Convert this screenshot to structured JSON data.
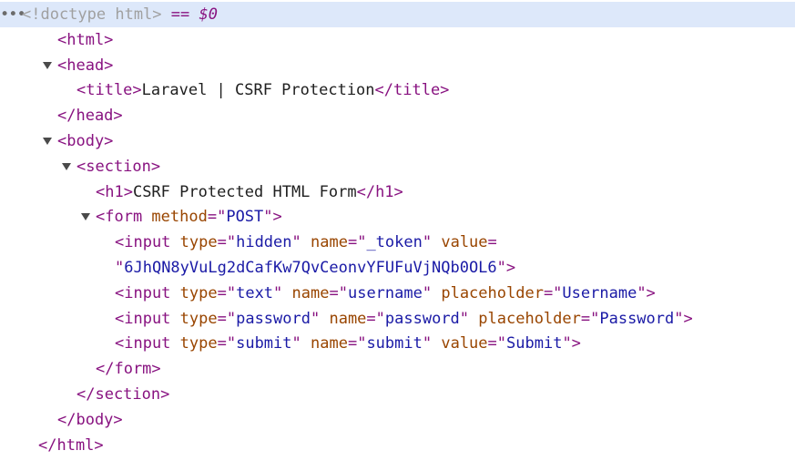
{
  "lines": [
    {
      "indent": 0,
      "selected": true,
      "dots": "•••",
      "tokens": [
        {
          "t": "dim",
          "v": "<!doctype html>"
        },
        {
          "t": "eq",
          "v": " == "
        },
        {
          "t": "dollar",
          "v": "$0"
        }
      ]
    },
    {
      "indent": 1,
      "tokens": [
        {
          "t": "tag",
          "v": "<html>"
        }
      ]
    },
    {
      "indent": 1,
      "arrow": true,
      "tokens": [
        {
          "t": "tag",
          "v": "<head>"
        }
      ]
    },
    {
      "indent": 2,
      "tokens": [
        {
          "t": "tag",
          "v": "<title>"
        },
        {
          "t": "text",
          "v": "Laravel | CSRF Protection"
        },
        {
          "t": "tag",
          "v": "</title>"
        }
      ]
    },
    {
      "indent": 1,
      "tokens": [
        {
          "t": "tag",
          "v": "</head>"
        }
      ]
    },
    {
      "indent": 1,
      "arrow": true,
      "tokens": [
        {
          "t": "tag",
          "v": "<body>"
        }
      ]
    },
    {
      "indent": 2,
      "arrow": true,
      "tokens": [
        {
          "t": "tag",
          "v": "<section>"
        }
      ]
    },
    {
      "indent": 3,
      "tokens": [
        {
          "t": "tag",
          "v": "<h1>"
        },
        {
          "t": "text",
          "v": "CSRF Protected HTML Form"
        },
        {
          "t": "tag",
          "v": "</h1>"
        }
      ]
    },
    {
      "indent": 3,
      "arrow": true,
      "tokens": [
        {
          "t": "tag",
          "v": "<form"
        },
        {
          "t": "attr",
          "v": " method"
        },
        {
          "t": "tag",
          "v": "=\""
        },
        {
          "t": "val",
          "v": "POST"
        },
        {
          "t": "tag",
          "v": "\">"
        }
      ]
    },
    {
      "indent": 4,
      "tokens": [
        {
          "t": "tag",
          "v": "<input"
        },
        {
          "t": "attr",
          "v": " type"
        },
        {
          "t": "tag",
          "v": "=\""
        },
        {
          "t": "val",
          "v": "hidden"
        },
        {
          "t": "tag",
          "v": "\""
        },
        {
          "t": "attr",
          "v": " name"
        },
        {
          "t": "tag",
          "v": "=\""
        },
        {
          "t": "val",
          "v": "_token"
        },
        {
          "t": "tag",
          "v": "\""
        },
        {
          "t": "attr",
          "v": " value"
        },
        {
          "t": "tag",
          "v": "="
        }
      ]
    },
    {
      "indent": 4,
      "tokens": [
        {
          "t": "tag",
          "v": "\""
        },
        {
          "t": "val",
          "v": "6JhQN8yVuLg2dCafKw7QvCeonvYFUFuVjNQb0OL6"
        },
        {
          "t": "tag",
          "v": "\">"
        }
      ]
    },
    {
      "indent": 4,
      "tokens": [
        {
          "t": "tag",
          "v": "<input"
        },
        {
          "t": "attr",
          "v": " type"
        },
        {
          "t": "tag",
          "v": "=\""
        },
        {
          "t": "val",
          "v": "text"
        },
        {
          "t": "tag",
          "v": "\""
        },
        {
          "t": "attr",
          "v": " name"
        },
        {
          "t": "tag",
          "v": "=\""
        },
        {
          "t": "val",
          "v": "username"
        },
        {
          "t": "tag",
          "v": "\""
        },
        {
          "t": "attr",
          "v": " placeholder"
        },
        {
          "t": "tag",
          "v": "=\""
        },
        {
          "t": "val",
          "v": "Username"
        },
        {
          "t": "tag",
          "v": "\">"
        }
      ]
    },
    {
      "indent": 4,
      "tokens": [
        {
          "t": "tag",
          "v": "<input"
        },
        {
          "t": "attr",
          "v": " type"
        },
        {
          "t": "tag",
          "v": "=\""
        },
        {
          "t": "val",
          "v": "password"
        },
        {
          "t": "tag",
          "v": "\""
        },
        {
          "t": "attr",
          "v": " name"
        },
        {
          "t": "tag",
          "v": "=\""
        },
        {
          "t": "val",
          "v": "password"
        },
        {
          "t": "tag",
          "v": "\""
        },
        {
          "t": "attr",
          "v": " placeholder"
        },
        {
          "t": "tag",
          "v": "=\""
        },
        {
          "t": "val",
          "v": "Password"
        },
        {
          "t": "tag",
          "v": "\">"
        }
      ]
    },
    {
      "indent": 4,
      "tokens": [
        {
          "t": "tag",
          "v": "<input"
        },
        {
          "t": "attr",
          "v": " type"
        },
        {
          "t": "tag",
          "v": "=\""
        },
        {
          "t": "val",
          "v": "submit"
        },
        {
          "t": "tag",
          "v": "\""
        },
        {
          "t": "attr",
          "v": " name"
        },
        {
          "t": "tag",
          "v": "=\""
        },
        {
          "t": "val",
          "v": "submit"
        },
        {
          "t": "tag",
          "v": "\""
        },
        {
          "t": "attr",
          "v": " value"
        },
        {
          "t": "tag",
          "v": "=\""
        },
        {
          "t": "val",
          "v": "Submit"
        },
        {
          "t": "tag",
          "v": "\">"
        }
      ]
    },
    {
      "indent": 3,
      "tokens": [
        {
          "t": "tag",
          "v": "</form>"
        }
      ]
    },
    {
      "indent": 2,
      "tokens": [
        {
          "t": "tag",
          "v": "</section>"
        }
      ]
    },
    {
      "indent": 1,
      "tokens": [
        {
          "t": "tag",
          "v": "</body>"
        }
      ]
    },
    {
      "indent": 0,
      "tokens": [
        {
          "t": "tag",
          "v": "</html>"
        }
      ]
    }
  ],
  "colors": {
    "tag": "#881280",
    "attr": "#994500",
    "val": "#1a1aa6",
    "selection": "#dde8fa"
  }
}
